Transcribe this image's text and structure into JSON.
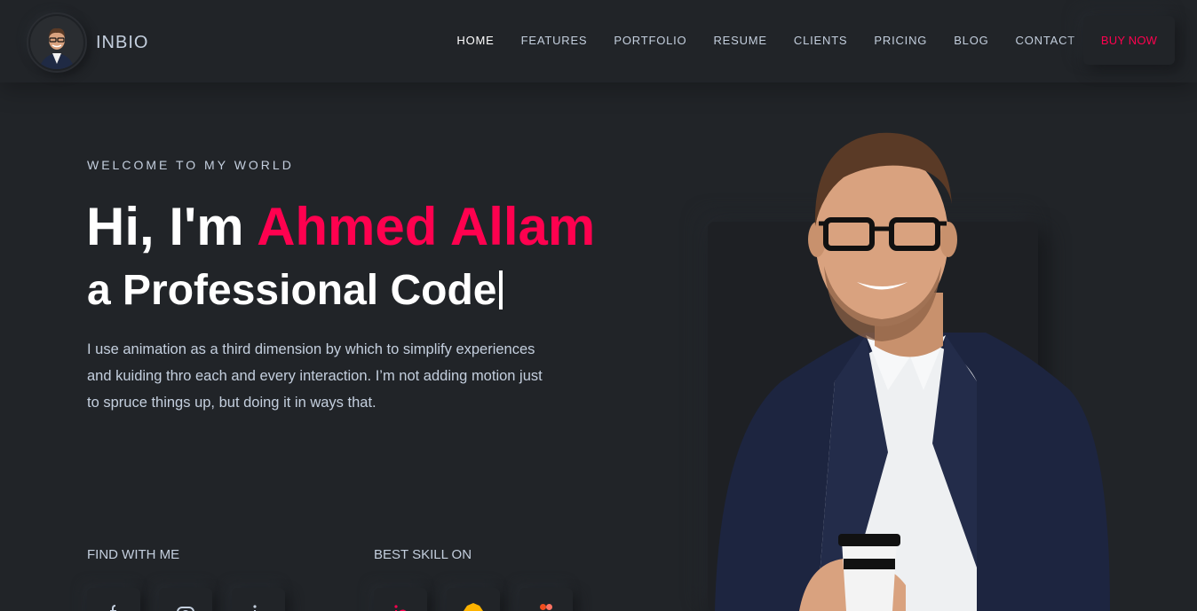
{
  "brand": {
    "name": "INBIO"
  },
  "nav": {
    "items": [
      {
        "label": "HOME"
      },
      {
        "label": "FEATURES"
      },
      {
        "label": "PORTFOLIO"
      },
      {
        "label": "RESUME"
      },
      {
        "label": "CLIENTS"
      },
      {
        "label": "PRICING"
      },
      {
        "label": "BLOG"
      },
      {
        "label": "CONTACT"
      }
    ],
    "cta_label": "BUY NOW"
  },
  "hero": {
    "eyebrow": "WELCOME TO MY WORLD",
    "greeting": "Hi, I'm ",
    "name": "Ahmed Allam",
    "subtitle": "a Professional Code",
    "description": "I use animation as a third dimension by which to simplify experiences and kuiding thro each and every interaction. I’m not adding motion just to spruce things up, but doing it in ways that."
  },
  "sections": {
    "find_label": "FIND WITH ME",
    "skill_label": "BEST SKILL ON"
  },
  "social_icons": [
    "facebook-icon",
    "instagram-icon",
    "linkedin-icon"
  ],
  "skill_icons": [
    "invision-icon",
    "sketch-icon",
    "figma-icon"
  ],
  "colors": {
    "accent": "#ff014f",
    "background": "#212428",
    "text": "#c4cfde"
  }
}
